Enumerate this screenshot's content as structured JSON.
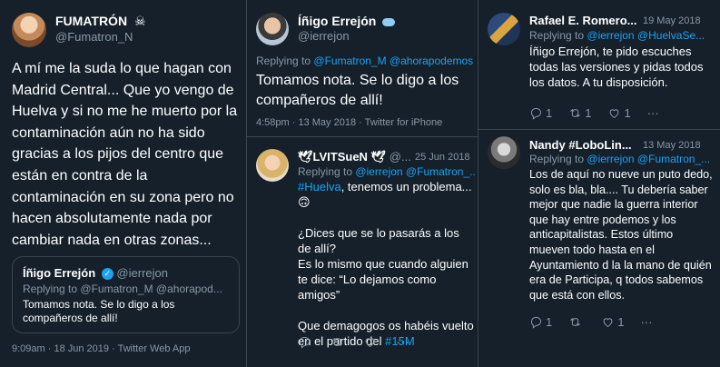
{
  "tweet1": {
    "author_name": "FUMATRÓN",
    "author_badge": "☠",
    "author_handle": "@Fumatron_N",
    "text": "A mí me la suda lo que hagan con Madrid Central... Que yo vengo de Huelva y si no me he muerto por la contaminación aún no ha sido gracias a los pijos del centro que están en contra de la contaminación en su zona pero no hacen absolutamente nada por cambiar nada en otras zonas...",
    "quote": {
      "author_name": "Íñigo Errejón",
      "author_handle": "@ierrejon",
      "replying_prefix": "Replying to",
      "replying_to": "@Fumatron_M @ahorapod...",
      "text": "Tomamos nota. Se lo digo a los compañeros de allí!"
    },
    "meta": "9:09am · 18 Jun 2019 · Twitter Web App"
  },
  "tweet2": {
    "author_name": "Íñigo Errejón",
    "author_handle": "@ierrejon",
    "replying_prefix": "Replying to",
    "replying_to": "@Fumatron_M @ahorapodemos",
    "text": "Tomamos nota. Se lo digo a los compañeros de allí!",
    "meta": "4:58pm · 13 May 2018 · Twitter for iPhone"
  },
  "reply_lvits": {
    "author_name": "🕊LVITSueN 🕊",
    "author_handle": "@...",
    "date": "25 Jun 2018",
    "replying_prefix": "Replying to",
    "replying_to": "@ierrejon @Fumatron_...",
    "hashtag_huelva": "#Huelva",
    "line1_rest": ", tenemos un problema... 🙃",
    "para2": "¿Dices que se lo pasarás a los de allí?\nEs lo mismo que cuando alguien te dice: “Lo dejamos como amigos”",
    "para3_prefix": "Que demagogos os habéis vuelto en el partido del ",
    "hashtag_15m": "#15M"
  },
  "reply_rafael": {
    "author_name": "Rafael E. Romero...",
    "date": "19 May 2018",
    "replying_prefix": "Replying to",
    "replying_to": "@ierrejon @HuelvaSe...",
    "text": "Íñigo Errejón, te pido escuches todas las versiones y pidas todos los datos. A tu disposición.",
    "replies": "1",
    "retweets": "1",
    "likes": "1",
    "more": "···"
  },
  "reply_nandy": {
    "author_name": "Nandy #LoboLin...",
    "date": "13 May 2018",
    "replying_prefix": "Replying to",
    "replying_to": "@ierrejon @Fumatron_...",
    "text": "Los de aquí no nueve un puto dedo, solo es bla, bla.... Tu debería saber mejor que nadie la guerra interior que hay entre podemos y los anticapitalistas. Estos último mueven todo hasta en el Ayuntamiento d la la mano de quién era de Participa, q todos sabemos que está con ellos.",
    "replies": "1",
    "likes": "1",
    "more": "···"
  },
  "colors": {
    "background": "#15202b",
    "border": "#38444d",
    "muted": "#8899a6",
    "link": "#1da1f2"
  }
}
